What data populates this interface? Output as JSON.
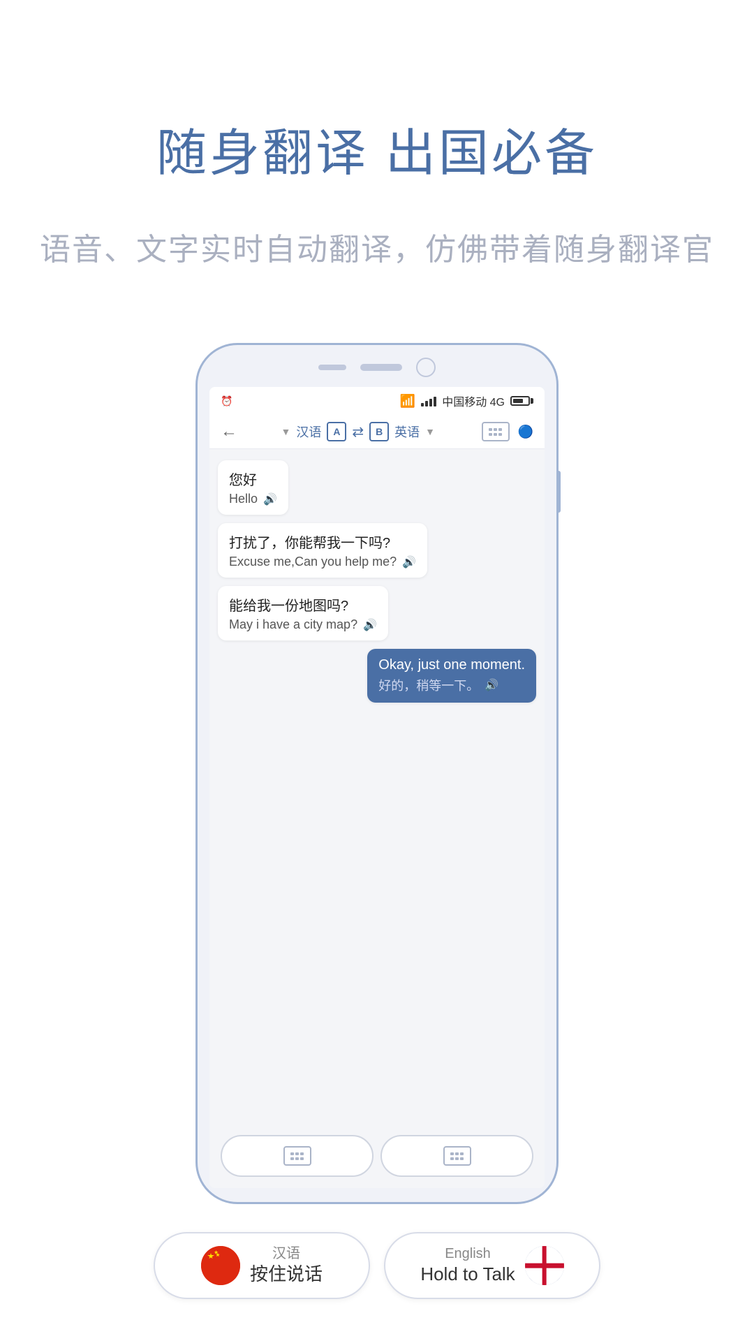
{
  "hero": {
    "title": "随身翻译 出国必备",
    "subtitle": "语音、文字实时自动翻译，仿佛带着随身翻译官"
  },
  "phone": {
    "statusBar": {
      "carrier": "中国移动 4G"
    },
    "header": {
      "sourceLang": "汉语",
      "sourceBadge": "A",
      "targetBadge": "B",
      "targetLang": "英语"
    },
    "messages": [
      {
        "chinese": "您好",
        "english": "Hello",
        "side": "left"
      },
      {
        "chinese": "打扰了，你能帮我一下吗?",
        "english": "Excuse me,Can you help me?",
        "side": "left"
      },
      {
        "chinese": "能给我一份地图吗?",
        "english": "May i have a city map?",
        "side": "left"
      },
      {
        "chinese": "好的，稍等一下。",
        "english": "Okay, just one moment.",
        "side": "right"
      }
    ]
  },
  "bottomButtons": {
    "left": {
      "lang": "汉语",
      "action": "按住说话",
      "flag": "cn"
    },
    "right": {
      "lang": "English",
      "action": "Hold to Talk",
      "flag": "uk"
    }
  }
}
